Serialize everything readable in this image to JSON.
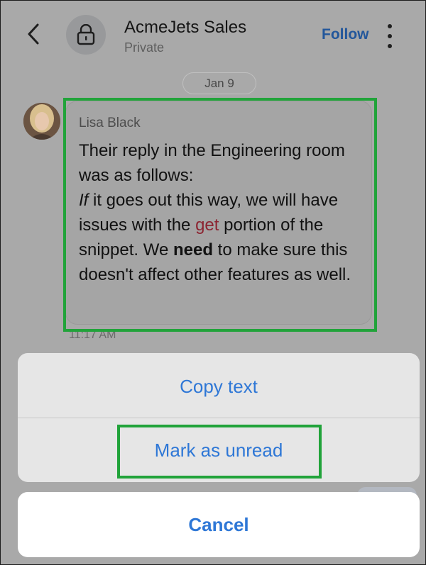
{
  "header": {
    "title": "AcmeJets Sales",
    "subtitle": "Private",
    "follow_label": "Follow",
    "back_icon": "chevron-left-icon",
    "lock_icon": "lock-icon",
    "more_icon": "more-vertical-icon"
  },
  "date_separator": "Jan 9",
  "message": {
    "sender": "Lisa Black",
    "line1": "Their reply in the Engineering room was as follows:",
    "italic_word": "If",
    "line2_a": " it goes out this way, we will have issues with the ",
    "code_word": "get",
    "line2_b": " portion of the snippet. We ",
    "bold_word": "need",
    "line2_c": " to make sure this doesn't affect other features as well.",
    "time": "11:17 AM"
  },
  "action_sheet": {
    "items": [
      {
        "label": "Copy text"
      },
      {
        "label": "Mark as unread"
      }
    ],
    "cancel_label": "Cancel"
  },
  "colors": {
    "accent": "#2e77d6",
    "follow": "#23579b",
    "highlight": "#21a33a",
    "code": "#8c2431"
  }
}
